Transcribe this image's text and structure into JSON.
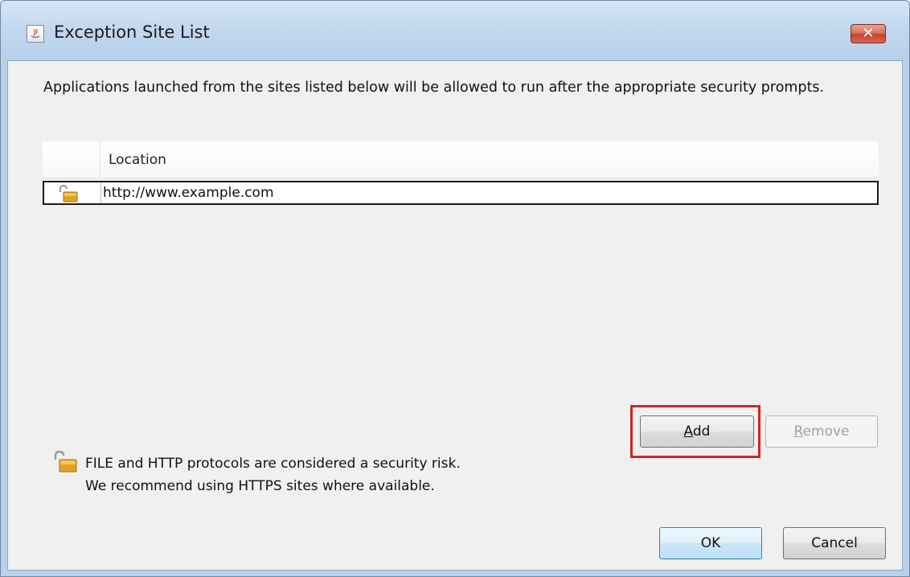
{
  "window": {
    "title": "Exception Site List",
    "app_icon": "java-icon",
    "close_label": "✕"
  },
  "description": "Applications launched from the sites listed below will be allowed to run after the appropriate security prompts.",
  "table": {
    "columns": [
      "",
      "Location"
    ],
    "rows": [
      {
        "icon": "unlock-warning-icon",
        "location": "http://www.example.com"
      }
    ]
  },
  "buttons": {
    "add": {
      "mnemonic": "A",
      "rest": "dd"
    },
    "remove": {
      "mnemonic": "R",
      "rest": "emove",
      "enabled": false
    },
    "ok": "OK",
    "cancel": "Cancel"
  },
  "warning": {
    "icon": "unlock-warning-icon",
    "line1": "FILE and HTTP protocols are considered a security risk.",
    "line2": "We recommend using HTTPS sites where available."
  },
  "colors": {
    "highlight": "#d8202a",
    "titlebar": "#c3d8ef",
    "close_button": "#c7412b"
  }
}
